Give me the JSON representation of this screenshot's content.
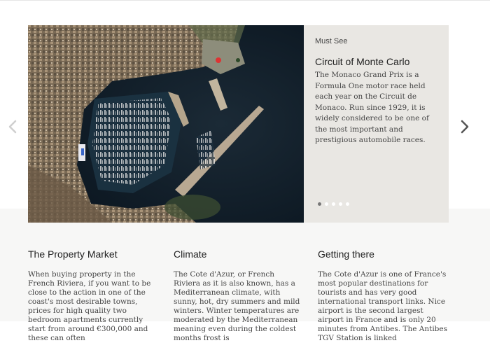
{
  "carousel": {
    "image_alt": "Aerial view of Monaco harbour",
    "eyebrow": "Must See",
    "title": "Circuit of Monte Carlo",
    "description": "The Monaco Grand Prix is a Formula One motor race held each year on the Circuit de Monaco. Run since 1929, it is widely considered to be one of the most important and prestigious automobile races.",
    "slide_count": 5,
    "active_slide": 1
  },
  "sections": [
    {
      "title": "The Property Market",
      "body": "When buying property in the French Riviera, if you want to be close to the action in one of the coast's most desirable towns, prices for high quality two bedroom apartments currently start from around €300,000 and these can often"
    },
    {
      "title": "Climate",
      "body": "The Cote d'Azur, or French Riviera as it is also known, has a Mediterranean climate, with sunny, hot, dry summers and mild winters. Winter temperatures are moderated by the Mediterranean meaning even during the coldest months frost is"
    },
    {
      "title": "Getting there",
      "body": "The Cote d'Azur is one of France's most popular destinations for tourists and has very good international transport links. Nice airport is the second largest airport in France and is only 20 minutes from Antibes. The Antibes TGV Station is linked"
    }
  ],
  "colors": {
    "caption_bg": "#e9e7e3",
    "lower_bg": "#f7f7f6",
    "dot_active": "#777777",
    "dot_inactive": "#ffffff"
  }
}
